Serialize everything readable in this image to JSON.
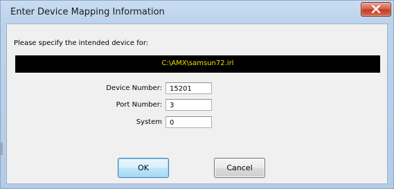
{
  "window": {
    "title": "Enter Device Mapping Information",
    "close_icon": "close-x-icon"
  },
  "dialog": {
    "prompt": "Please specify the intended device for:",
    "file_path": "C:\\AMX\\samsun72.irl",
    "fields": {
      "device_number": {
        "label": "Device Number:",
        "value": "15201"
      },
      "port_number": {
        "label": "Port Number:",
        "value": "3"
      },
      "system": {
        "label": "System",
        "value": "0"
      }
    },
    "buttons": {
      "ok": "OK",
      "cancel": "Cancel"
    }
  },
  "colors": {
    "path_bar_background": "#000000",
    "path_text": "#f2e000",
    "close_button": "#c23c25"
  }
}
